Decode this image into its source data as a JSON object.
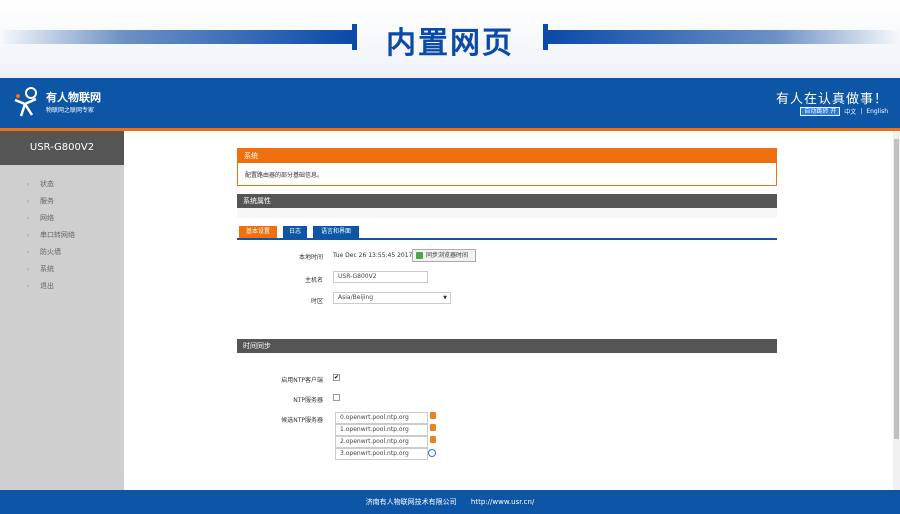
{
  "banner": {
    "title": "内置网页"
  },
  "header": {
    "logo_name": "有人物联网",
    "logo_sub": "物联网之联网专家",
    "slogan": "有人在认真做事！",
    "auto_switch_label": "自动跳转 开",
    "lang_zh": "中文",
    "lang_sep": "|",
    "lang_en": "English"
  },
  "sidebar": {
    "device_name": "USR-G800V2",
    "items": [
      {
        "label": "状态"
      },
      {
        "label": "服务"
      },
      {
        "label": "网络"
      },
      {
        "label": "串口转网络"
      },
      {
        "label": "防火墙"
      },
      {
        "label": "系统"
      },
      {
        "label": "退出"
      }
    ]
  },
  "system_section": {
    "title": "系统",
    "description": "配置路由器的部分基础信息。"
  },
  "props_section": {
    "title": "系统属性"
  },
  "tabs": [
    {
      "label": "基本设置",
      "active": true
    },
    {
      "label": "日志",
      "active": false
    },
    {
      "label": "语言和界面",
      "active": false
    }
  ],
  "fields": {
    "local_time_label": "本地时间",
    "local_time_value": "Tue Dec 26 13:55:45 2017",
    "sync_button": "同步浏览器时间",
    "hostname_label": "主机名",
    "hostname_value": "USR-G800V2",
    "timezone_label": "时区",
    "timezone_value": "Asia/Beijing"
  },
  "time_sync_section": {
    "title": "时间同步"
  },
  "ntp": {
    "enable_client_label": "启用NTP客户端",
    "enable_client_checked": true,
    "server_label": "NTP服务器",
    "server_checked": false,
    "candidates_label": "候选NTP服务器",
    "servers": [
      "0.openwrt.pool.ntp.org",
      "1.openwrt.pool.ntp.org",
      "2.openwrt.pool.ntp.org",
      "3.openwrt.pool.ntp.org"
    ]
  },
  "footer": {
    "company": "济南有人物联网技术有限公司",
    "url": "http://www.usr.cn/"
  },
  "colors": {
    "brand_blue": "#0d56a6",
    "accent_orange": "#f0700f",
    "dark_gray": "#555555"
  }
}
